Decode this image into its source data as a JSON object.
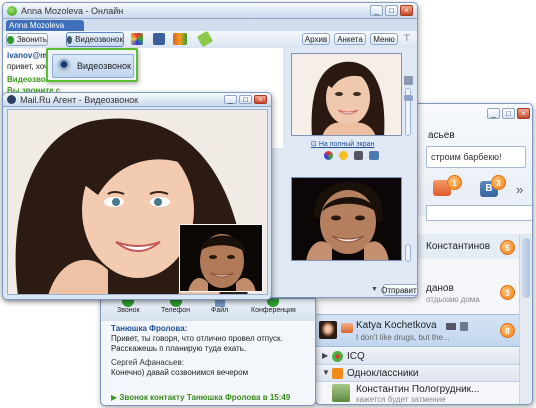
{
  "main_window": {
    "title": "Anna Mozoleva - Онлайн",
    "tab": "Anna Mozoleva",
    "call_button": "Звонить",
    "video_call_button": "Видеозвонок",
    "right_buttons": [
      "Архив",
      "Анкета",
      "Меню"
    ],
    "dropdown_item": "Видеозвонок",
    "chat_lines": [
      {
        "text": "ivanov@mail.r",
        "style": "blue-bold"
      },
      {
        "text": "привет, хочу т",
        "style": "normal"
      },
      {
        "text": "Видеозвонок",
        "style": "green"
      },
      {
        "text": "Вы звоните с",
        "style": "green"
      }
    ],
    "fullscreen_link": "На полный экран",
    "send_button": "Отправить"
  },
  "video_window": {
    "title": "Mail.Ru Агент - Видеозвонок"
  },
  "right_panel": {
    "name": "асьев",
    "status_text": "строим барбекю!",
    "badge_1": "1",
    "badge_3": "3",
    "more": "»",
    "contacts": [
      {
        "name": "Константинов",
        "sub": "",
        "badge": "5"
      },
      {
        "name": "данов",
        "sub": "отдыхаю дома",
        "badge": "3"
      },
      {
        "name": "Katya Kochetkova",
        "sub": "I don't like drugs, but the...",
        "badge": "8"
      }
    ],
    "groups": [
      {
        "name": "ICQ"
      },
      {
        "name": "Одноклассники"
      }
    ],
    "last_contact": {
      "name": "Константин Пологрудник...",
      "sub": "кажется будет затмение"
    }
  },
  "bottom_chat": {
    "buttons": [
      "Звонок",
      "Телефон",
      "Файл",
      "Конференция"
    ],
    "messages": [
      {
        "sender": "Танюшка Фролова:",
        "text": "Привет, ты говоря, что отлично провел отпуск. Расскажешь п планирую туда ехать."
      },
      {
        "sender": "Сергей Афанасьев:",
        "text": "Конечно) давай созвонимся вечером"
      }
    ],
    "call_notice": "Звонок контакту Танюшка Фролова в 15:49"
  }
}
